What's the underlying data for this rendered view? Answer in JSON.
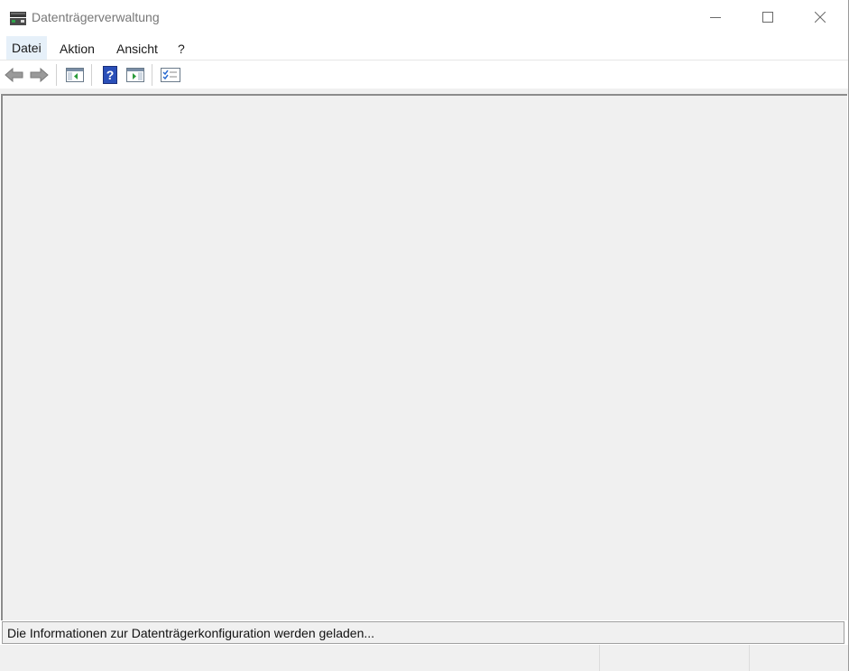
{
  "window": {
    "title": "Datenträgerverwaltung",
    "app_icon": "disk-management-icon",
    "controls": [
      "minimize-icon",
      "maximize-icon",
      "close-icon"
    ]
  },
  "menu": {
    "items": [
      {
        "label": "Datei"
      },
      {
        "label": "Aktion"
      },
      {
        "label": "Ansicht"
      },
      {
        "label": "?"
      }
    ]
  },
  "toolbar": {
    "buttons": [
      "back-arrow-icon",
      "forward-arrow-icon",
      "show-hide-console-tree-icon",
      "help-icon",
      "show-hide-action-pane-icon",
      "properties-icon"
    ]
  },
  "status": {
    "message": "Die Informationen zur Datenträgerkonfiguration werden geladen..."
  },
  "colors": {
    "content_bg": "#f0f0f0",
    "menu_active_bg": "#e6f0f9",
    "title_text": "#777777"
  }
}
